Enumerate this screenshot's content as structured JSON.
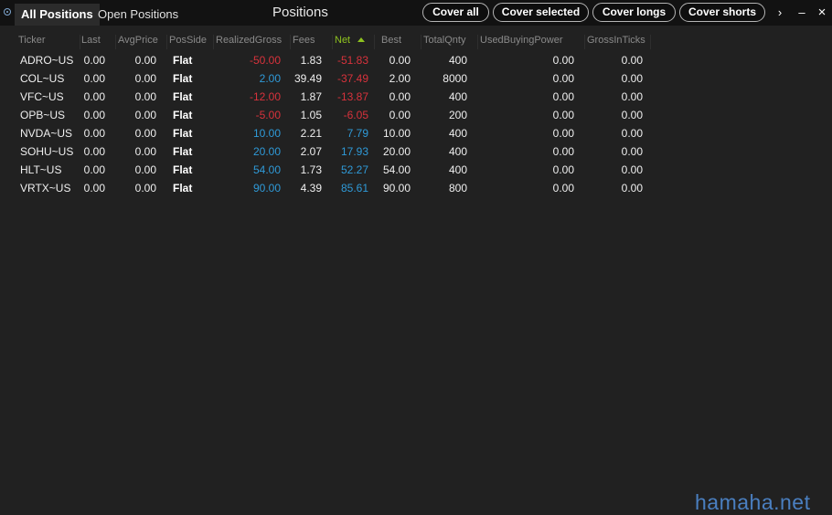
{
  "tabs": [
    {
      "label": "All Positions",
      "active": true
    },
    {
      "label": "Open Positions",
      "active": false
    }
  ],
  "window_title": "Positions",
  "buttons": {
    "cover_all": "Cover all",
    "cover_selected": "Cover selected",
    "cover_longs": "Cover longs",
    "cover_shorts": "Cover shorts"
  },
  "controls": {
    "more": "›",
    "minimize": "–",
    "close": "×"
  },
  "table": {
    "headers": [
      "Ticker",
      "Last",
      "AvgPrice",
      "PosSide",
      "RealizedGross",
      "Fees",
      "Net",
      "Best",
      "TotalQnty",
      "UsedBuyingPower",
      "GrossInTicks"
    ],
    "sorted_column": "Net",
    "rows": [
      [
        "ADRO~US",
        "0.00",
        "0.00",
        "Flat",
        "-50.00",
        "1.83",
        "-51.83",
        "0.00",
        "400",
        "0.00",
        "0.00"
      ],
      [
        "COL~US",
        "0.00",
        "0.00",
        "Flat",
        "2.00",
        "39.49",
        "-37.49",
        "2.00",
        "8000",
        "0.00",
        "0.00"
      ],
      [
        "VFC~US",
        "0.00",
        "0.00",
        "Flat",
        "-12.00",
        "1.87",
        "-13.87",
        "0.00",
        "400",
        "0.00",
        "0.00"
      ],
      [
        "OPB~US",
        "0.00",
        "0.00",
        "Flat",
        "-5.00",
        "1.05",
        "-6.05",
        "0.00",
        "200",
        "0.00",
        "0.00"
      ],
      [
        "NVDA~US",
        "0.00",
        "0.00",
        "Flat",
        "10.00",
        "2.21",
        "7.79",
        "10.00",
        "400",
        "0.00",
        "0.00"
      ],
      [
        "SOHU~US",
        "0.00",
        "0.00",
        "Flat",
        "20.00",
        "2.07",
        "17.93",
        "20.00",
        "400",
        "0.00",
        "0.00"
      ],
      [
        "HLT~US",
        "0.00",
        "0.00",
        "Flat",
        "54.00",
        "1.73",
        "52.27",
        "54.00",
        "400",
        "0.00",
        "0.00"
      ],
      [
        "VRTX~US",
        "0.00",
        "0.00",
        "Flat",
        "90.00",
        "4.39",
        "85.61",
        "90.00",
        "800",
        "0.00",
        "0.00"
      ]
    ]
  },
  "colors": {
    "negative": "#d8323c",
    "positive": "#2f9ad8",
    "sort_accent": "#8ec21f"
  },
  "watermark": "hamaha.net"
}
